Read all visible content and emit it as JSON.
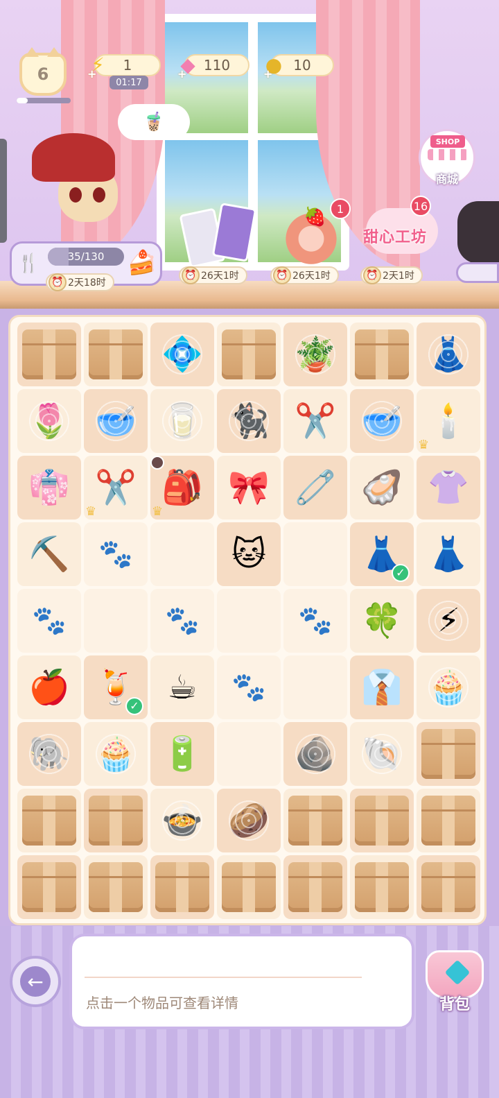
{
  "hud": {
    "level": "6",
    "xp_fraction": 0.2,
    "energy": "1",
    "energy_timer": "01:17",
    "gems": "110",
    "coins": "10"
  },
  "task": {
    "progress_text": "35/130",
    "progress_fraction": 0.27,
    "timer": "2天18时"
  },
  "events": {
    "cards_timer": "26天1时",
    "roll_timer": "26天1时",
    "roll_badge": "1",
    "sweet_title": "甜心工坊",
    "sweet_timer": "2天1时",
    "sweet_badge": "16"
  },
  "shop": {
    "sign": "SHOP",
    "label": "商城"
  },
  "board": {
    "rows": [
      [
        {
          "i": "box"
        },
        {
          "i": "box"
        },
        {
          "i": "💠",
          "web": true
        },
        {
          "i": "box"
        },
        {
          "i": "🪴",
          "web": true
        },
        {
          "i": "box"
        },
        {
          "i": "👗",
          "web": true
        }
      ],
      [
        {
          "i": "🌷",
          "web": true
        },
        {
          "i": "🥣",
          "web": true
        },
        {
          "i": "🥛",
          "web": true
        },
        {
          "i": "🐈‍⬛",
          "web": true
        },
        {
          "i": "✂️"
        },
        {
          "i": "🥣",
          "web": true
        },
        {
          "i": "🕯️",
          "crown": true
        }
      ],
      [
        {
          "i": "👘"
        },
        {
          "i": "✂️",
          "crown": true
        },
        {
          "i": "🎒",
          "crown": true,
          "lock": true
        },
        {
          "i": "🎀"
        },
        {
          "i": "🧷"
        },
        {
          "i": "🦪"
        },
        {
          "i": "👚"
        }
      ],
      [
        {
          "i": "⛏️"
        },
        {
          "i": "paw"
        },
        {
          "i": ""
        },
        {
          "i": "🐱"
        },
        {
          "i": ""
        },
        {
          "i": "👗",
          "check": true
        },
        {
          "i": "👗"
        }
      ],
      [
        {
          "i": "paw"
        },
        {
          "i": ""
        },
        {
          "i": "paw"
        },
        {
          "i": ""
        },
        {
          "i": "paw"
        },
        {
          "i": "🍀"
        },
        {
          "i": "⚡",
          "web": true
        }
      ],
      [
        {
          "i": "🍎"
        },
        {
          "i": "🍹",
          "check": true
        },
        {
          "i": "☕"
        },
        {
          "i": "paw"
        },
        {
          "i": ""
        },
        {
          "i": "👔"
        },
        {
          "i": "🧁",
          "web": true
        }
      ],
      [
        {
          "i": "🐘",
          "web": true
        },
        {
          "i": "🧁",
          "web": true
        },
        {
          "i": "🔋"
        },
        {
          "i": ""
        },
        {
          "i": "🪨",
          "web": true
        },
        {
          "i": "🐚",
          "web": true
        },
        {
          "i": "box"
        }
      ],
      [
        {
          "i": "box"
        },
        {
          "i": "box"
        },
        {
          "i": "🍲",
          "web": true
        },
        {
          "i": "🥔",
          "web": true
        },
        {
          "i": "box"
        },
        {
          "i": "box"
        },
        {
          "i": "box"
        }
      ],
      [
        {
          "i": "box"
        },
        {
          "i": "box"
        },
        {
          "i": "box"
        },
        {
          "i": "box"
        },
        {
          "i": "box"
        },
        {
          "i": "box"
        },
        {
          "i": "box"
        }
      ]
    ]
  },
  "info": {
    "hint": "点击一个物品可查看详情"
  },
  "bag": {
    "label": "背包"
  },
  "colors": {
    "accent_purple": "#b69ad8",
    "badge_red": "#e94b63",
    "check_green": "#35c27a"
  }
}
